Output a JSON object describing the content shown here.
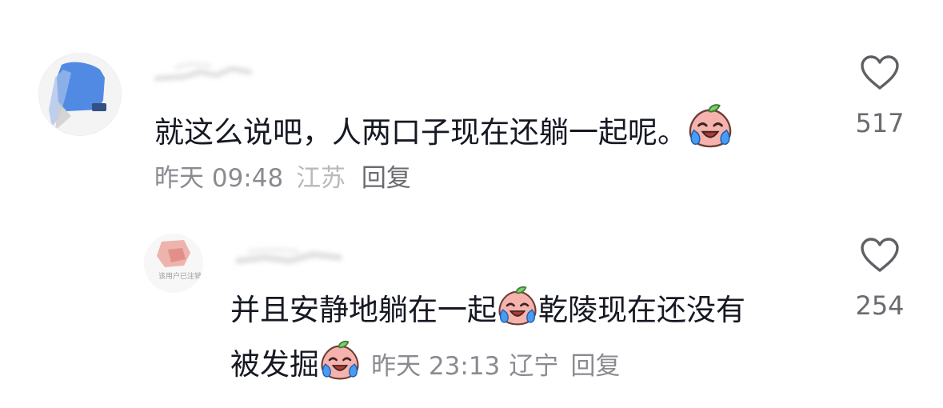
{
  "comments": [
    {
      "text": "就这么说吧，人两口子现在还躺一起呢。",
      "time": "昨天 09:48",
      "location": "江苏",
      "reply_label": "回复",
      "likes": "517",
      "emoji": "crying-laughing-peach-emoji"
    },
    {
      "avatar_text": "该用户已注销",
      "text_line1_a": "并且安静地躺在一起",
      "text_line1_b": "乾陵现在还没有",
      "text_line2": "被发掘",
      "time": "昨天 23:13",
      "location": "辽宁",
      "reply_label": "回复",
      "likes": "254",
      "emoji": "crying-laughing-peach-emoji"
    }
  ],
  "colors": {
    "text": "#161823",
    "meta": "#8a8b91",
    "like_icon": "#5f6066"
  }
}
